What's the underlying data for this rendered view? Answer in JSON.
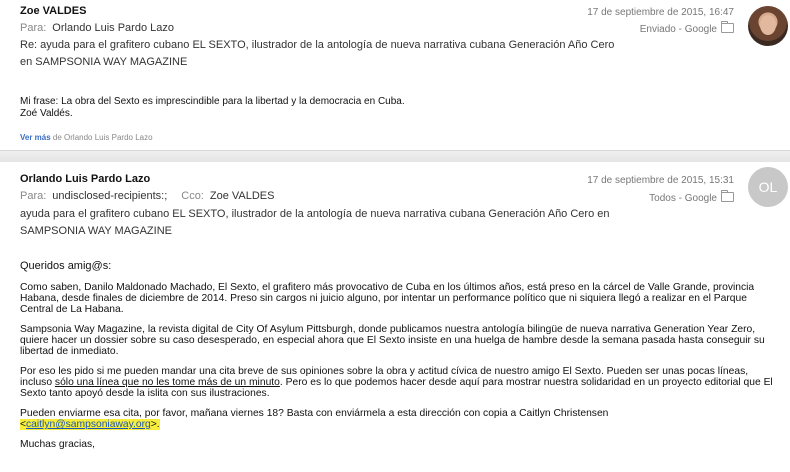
{
  "message1": {
    "sender": "Zoe VALDES",
    "to_label": "Para:",
    "to": "Orlando Luis Pardo Lazo",
    "date": "17 de septiembre de 2015, 16:47",
    "folder": "Enviado - Google",
    "subject_line1": "Re: ayuda para el grafitero cubano EL SEXTO, ilustrador de la antología de nueva narrativa cubana Generación Año Cero",
    "subject_line2": "en SAMPSONIA WAY MAGAZINE",
    "body_line1": "Mi frase: La obra del Sexto es imprescindible para la libertad y la democracia en Cuba.",
    "body_line2": "Zoé Valdés.",
    "see_more_link": "Ver más",
    "see_more_suffix": " de Orlando Luis Pardo Lazo"
  },
  "message2": {
    "sender": "Orlando Luis Pardo Lazo",
    "to_label": "Para:",
    "to": "undisclosed-recipients:;",
    "cc_label": "Cco:",
    "cc": "Zoe VALDES",
    "date": "17 de septiembre de 2015, 15:31",
    "folder": "Todos - Google",
    "avatar_initials": "OL",
    "subject_line1": "ayuda para el grafitero cubano EL SEXTO, ilustrador de la antología de nueva narrativa cubana Generación Año Cero en",
    "subject_line2": "SAMPSONIA WAY MAGAZINE",
    "greeting": "Queridos amig@s:",
    "p1": "Como saben, Danilo Maldonado Machado, El Sexto, el grafitero más provocativo de Cuba en los últimos años, está preso en la cárcel de Valle Grande, provincia Habana, desde finales de diciembre de 2014. Preso sin cargos ni juicio alguno, por intentar un performance político que ni siquiera llegó a realizar en el Parque Central de La Habana.",
    "p2": "Sampsonia Way Magazine, la revista digital de City Of Asylum Pittsburgh, donde publicamos nuestra antología bilingüe de nueva narrativa Generation Year Zero, quiere hacer un dossier sobre su caso desesperado, en especial ahora que El Sexto insiste en una huelga de hambre desde la semana pasada hasta conseguir su libertad de inmediato.",
    "p3_before": "Por eso les pido si me pueden mandar una cita breve de sus opiniones sobre la obra y actitud cívica de nuestro amigo El Sexto. Pueden ser unas pocas líneas, incluso ",
    "p3_underlined": "sólo una línea que no les tome más de un minuto",
    "p3_after": ". Pero es lo que podemos hacer desde aquí para mostrar nuestra solidaridad en un proyecto editorial que El Sexto tanto apoyó desde la islita con sus ilustraciones.",
    "p4_text": "Pueden enviarme esa cita, por favor, mañana viernes 18? Basta con enviármela a esta dirección con copia a Caitlyn Christensen",
    "p4_email_open": "<",
    "p4_email": "caitlyn@sampsoniaway.org",
    "p4_email_close": ">.",
    "closing": "Muchas gracias,"
  }
}
